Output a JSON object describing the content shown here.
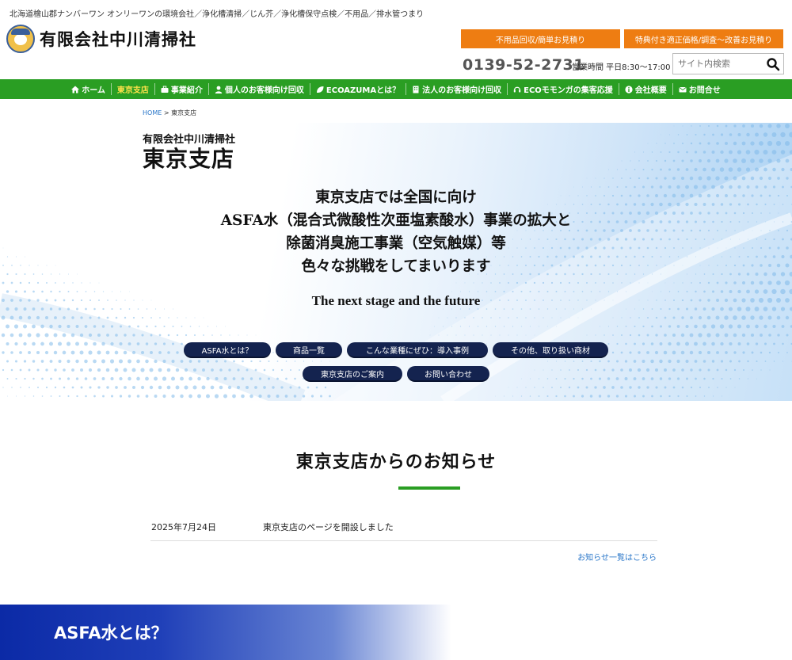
{
  "header": {
    "tagline": "北海道檜山郡ナンバーワン オンリーワンの環境会社／浄化槽清掃／じん芥／浄化槽保守点検／不用品／排水管つまり",
    "company": "有限会社中川清掃社",
    "btn_estimate": "不用品回収/簡単お見積り",
    "btn_special": "特典付き適正価格/調査〜改善お見積り",
    "phone": "0139-52-2731",
    "hours": "営業時間 平日8:30〜17:00",
    "search_placeholder": "サイト内検索"
  },
  "nav": {
    "items": [
      {
        "label": "ホーム",
        "icon": "home-icon"
      },
      {
        "label": "東京支店",
        "icon": ""
      },
      {
        "label": "事業紹介",
        "icon": "briefcase-icon"
      },
      {
        "label": "個人のお客様向け回収",
        "icon": "user-icon"
      },
      {
        "label": "ECOAZUMAとは？",
        "icon": "leaf-icon"
      },
      {
        "label": "法人のお客様向け回収",
        "icon": "building-icon"
      },
      {
        "label": "ECOモモンガの集客応援",
        "icon": "headset-icon"
      },
      {
        "label": "会社概要",
        "icon": "info-icon"
      },
      {
        "label": "お問合せ",
        "icon": "mail-icon"
      }
    ]
  },
  "breadcrumb": {
    "home": "HOME",
    "sep": ">",
    "current": "東京支店"
  },
  "hero": {
    "company": "有限会社中川清掃社",
    "branch": "東京支店",
    "line1": "東京支店では全国に向け",
    "line2": "ASFA水（混合式微酸性次亜塩素酸水）事業の拡大と",
    "line3": "除菌消臭施工事業（空気触媒）等",
    "line4": "色々な挑戦をしてまいります",
    "subtitle": "The next stage and the future",
    "buttons": [
      "ASFA水とは？",
      "商品一覧",
      "こんな業種にぜひ：導入事例",
      "その他、取り扱い商材",
      "東京支店のご案内",
      "お問い合わせ"
    ]
  },
  "news": {
    "title": "東京支店からのお知らせ",
    "items": [
      {
        "date": "2025年7月24日",
        "text": "東京支店のページを開設しました"
      }
    ],
    "more": "お知らせ一覧はこちら"
  },
  "asfa": {
    "title": "ASFA水とは？"
  },
  "colors": {
    "green": "#2a9e23",
    "orange": "#ee7d12",
    "navy": "#14234f",
    "link": "#2a77c9"
  }
}
